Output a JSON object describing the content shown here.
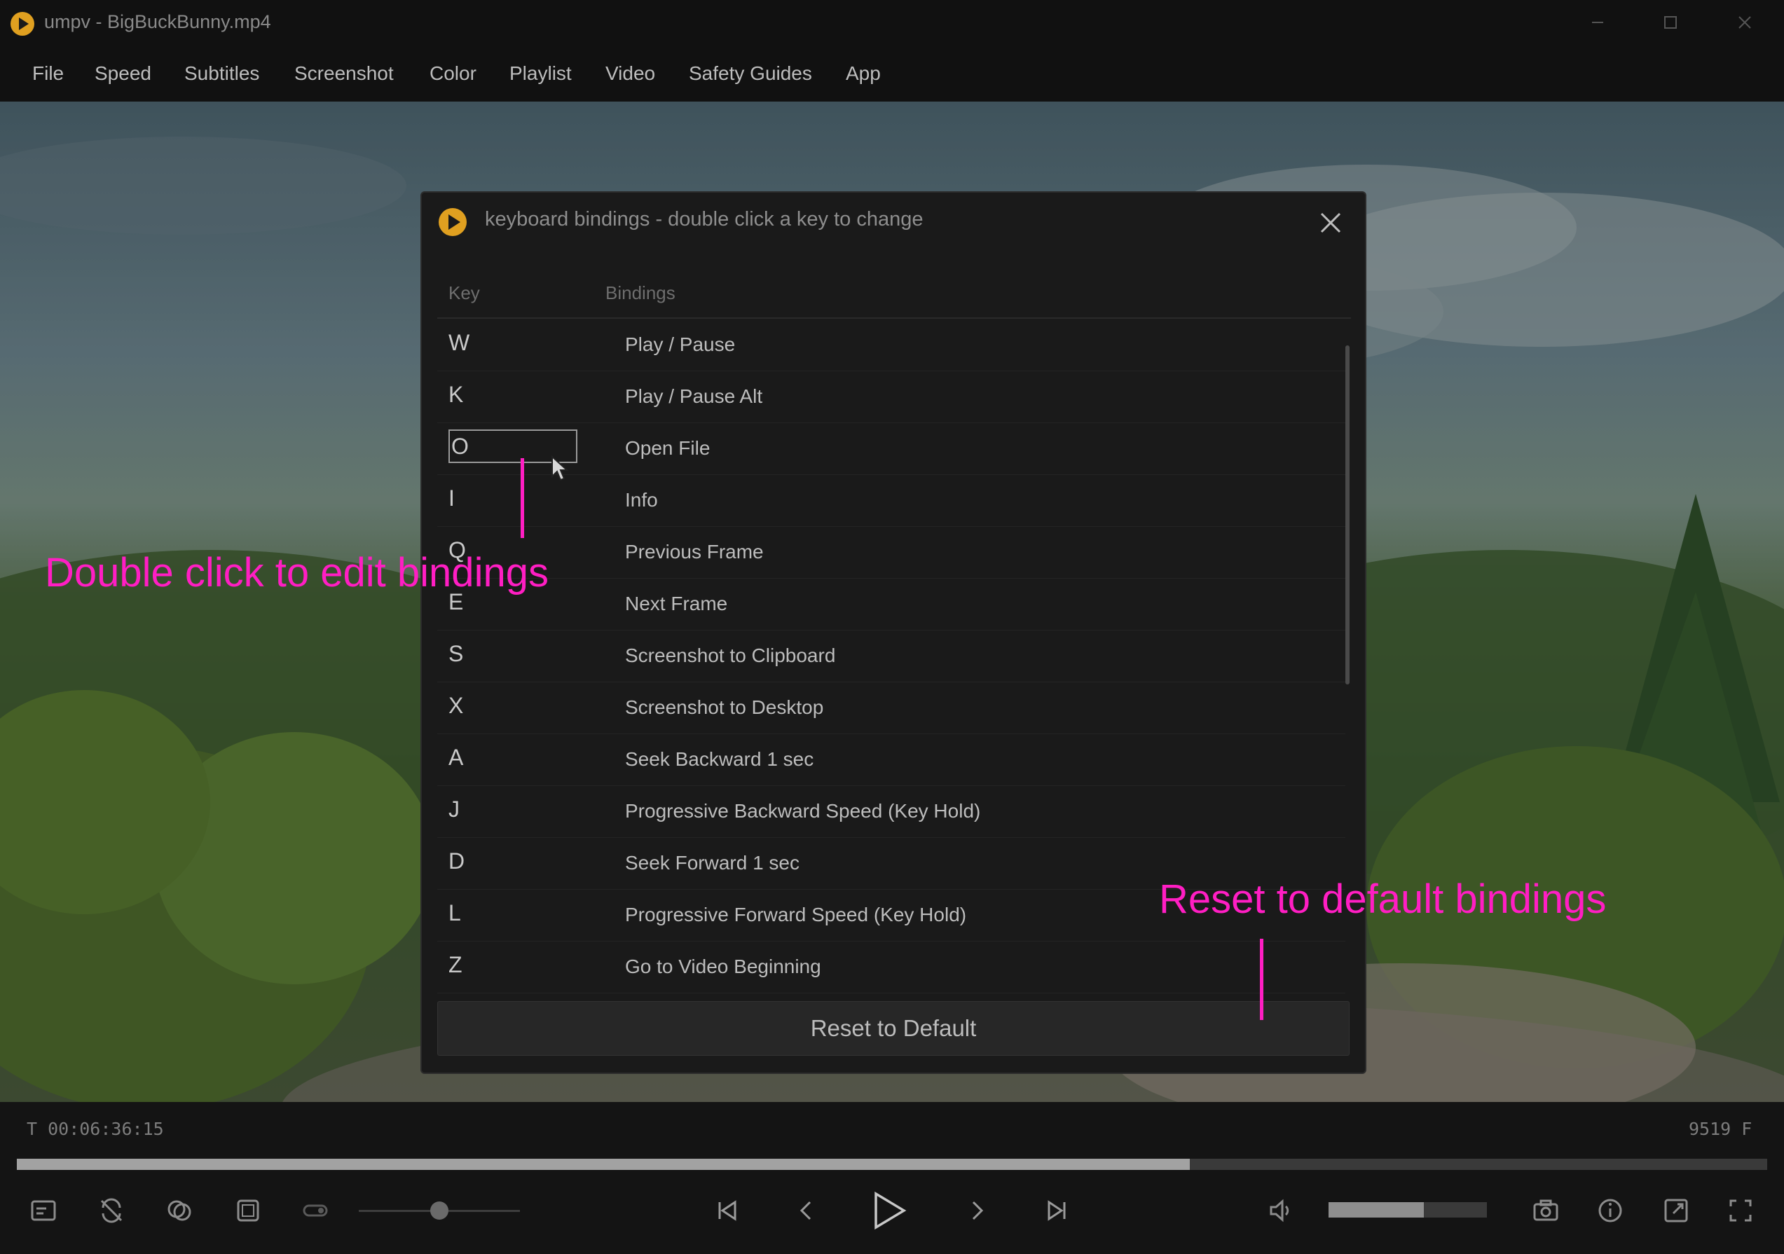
{
  "window": {
    "title": "umpv - BigBuckBunny.mp4"
  },
  "menu": [
    "File",
    "Speed",
    "Subtitles",
    "Screenshot",
    "Color",
    "Playlist",
    "Video",
    "Safety Guides",
    "App"
  ],
  "dialog": {
    "title": "keyboard bindings - double click a key to change",
    "columns": {
      "key": "Key",
      "binding": "Bindings"
    },
    "rows": [
      {
        "key": "W",
        "binding": "Play / Pause"
      },
      {
        "key": "K",
        "binding": "Play / Pause Alt"
      },
      {
        "key": "O",
        "binding": "Open File"
      },
      {
        "key": "I",
        "binding": "Info"
      },
      {
        "key": "Q",
        "binding": "Previous Frame"
      },
      {
        "key": "E",
        "binding": "Next Frame"
      },
      {
        "key": "S",
        "binding": "Screenshot to Clipboard"
      },
      {
        "key": "X",
        "binding": "Screenshot to Desktop"
      },
      {
        "key": "A",
        "binding": "Seek Backward 1 sec"
      },
      {
        "key": "J",
        "binding": "Progressive Backward Speed (Key Hold)"
      },
      {
        "key": "D",
        "binding": "Seek Forward 1 sec"
      },
      {
        "key": "L",
        "binding": "Progressive Forward Speed (Key Hold)"
      },
      {
        "key": "Z",
        "binding": "Go to Video Beginning"
      }
    ],
    "selected_key": "O",
    "reset_label": "Reset to Default"
  },
  "annotations": {
    "edit": "Double click  to edit bindings",
    "reset": "Reset to default bindings",
    "color": "#ff1ec3"
  },
  "player": {
    "timecode": "T  00:06:36:15",
    "frame_count": "9519  F",
    "progress": 0.67,
    "speed_slider_level": 0.5,
    "volume": 0.6
  },
  "icons": {
    "app_logo": "play-logo-icon",
    "controls": [
      "subtitles-icon",
      "no-loop-icon",
      "color-filter-icon",
      "crop-icon",
      "toggle-icon",
      "skip-start-icon",
      "previous-icon",
      "play-icon",
      "next-icon",
      "skip-end-icon",
      "volume-icon",
      "camera-icon",
      "info-icon",
      "resize-icon",
      "fullscreen-icon"
    ]
  },
  "colors": {
    "accent": "#e0a020",
    "annotation": "#ff1ec3"
  }
}
